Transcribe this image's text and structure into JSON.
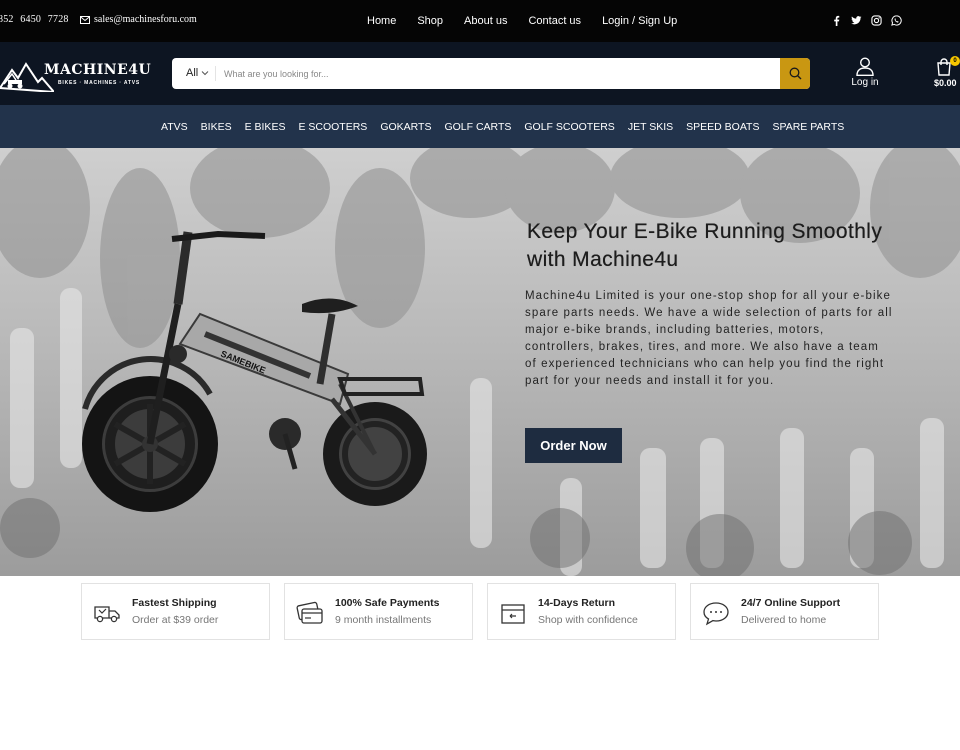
{
  "topbar": {
    "phone": "852 6450 7728",
    "email": "sales@machinesforu.com",
    "nav": [
      "Home",
      "Shop",
      "About us",
      "Contact us",
      "Login / Sign Up"
    ],
    "social": [
      "facebook-icon",
      "twitter-icon",
      "instagram-icon",
      "whatsapp-icon"
    ]
  },
  "header": {
    "logo_name": "MACHINE4U",
    "logo_tagline": "BIKES · MACHINES · ATVS",
    "search": {
      "category": "All",
      "placeholder": "What are you looking for..."
    },
    "login_label": "Log in",
    "cart_count": "0",
    "cart_total": "$0.00"
  },
  "categories": [
    "ATVS",
    "BIKES",
    "E BIKES",
    "E SCOOTERS",
    "GOKARTS",
    "GOLF CARTS",
    "GOLF SCOOTERS",
    "JET SKIS",
    "SPEED BOATS",
    "SPARE PARTS"
  ],
  "hero": {
    "heading": "Keep Your E-Bike Running Smoothly with Machine4u",
    "body": "Machine4u Limited is your one-stop shop for all your e-bike spare parts needs. We have a wide selection of parts for all major e-bike brands, including batteries, motors, controllers, brakes, tires, and more. We also have a team of experienced technicians who can help you find the right part for your needs and install it for you.",
    "cta": "Order Now",
    "bike_brand": "SAMEBIKE"
  },
  "features": [
    {
      "icon": "delivery-truck-icon",
      "title": "Fastest Shipping",
      "subtitle": "Order at $39 order"
    },
    {
      "icon": "credit-card-icon",
      "title": "100% Safe Payments",
      "subtitle": "9 month installments"
    },
    {
      "icon": "return-box-icon",
      "title": "14-Days Return",
      "subtitle": "Shop with confidence"
    },
    {
      "icon": "chat-bubble-icon",
      "title": "24/7 Online Support",
      "subtitle": "Delivered to home"
    }
  ],
  "colors": {
    "topbar_bg": "#050505",
    "header_bg": "#0d1522",
    "catnav_bg": "#22334b",
    "search_button": "#c99712",
    "cta_bg": "#1e2c40",
    "cart_badge": "#f7c600"
  }
}
